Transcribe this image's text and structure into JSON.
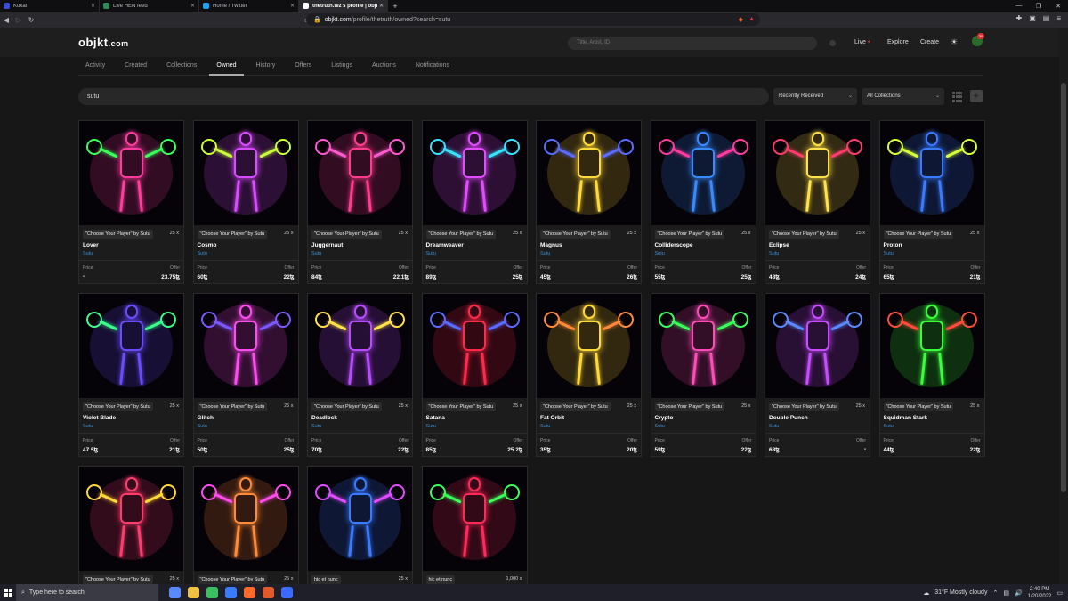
{
  "browser": {
    "tabs": [
      {
        "label": "Kokai",
        "color": "#3b4bd8"
      },
      {
        "label": "Live HEN feed",
        "color": "#2e8b57"
      },
      {
        "label": "Home / Twitter",
        "color": "#1da1f2"
      },
      {
        "label": "thetruth.tez's profile | objkt.com",
        "color": "#ffffff",
        "active": true
      }
    ],
    "new_tab": "+",
    "window_controls": [
      "—",
      "❐",
      "✕"
    ],
    "url_host": "objkt.com",
    "url_path": "/profile/thetruth/owned?search=sutu"
  },
  "header": {
    "logo": "objkt",
    "logo_suffix": ".com",
    "search_placeholder": "Title, Artist, ID",
    "live": "Live",
    "explore": "Explore",
    "create": "Create",
    "notifications_count": "39"
  },
  "subnav": [
    "Activity",
    "Created",
    "Collections",
    "Owned",
    "History",
    "Offers",
    "Listings",
    "Auctions",
    "Notifications"
  ],
  "subnav_active": "Owned",
  "filter": {
    "search_value": "sutu",
    "sort": "Recently Received",
    "collections": "All Collections"
  },
  "labels": {
    "price": "Price",
    "offer": "Offer"
  },
  "cards": [
    {
      "collection": "\"Choose Your Player\" by Sutu",
      "editions": "25 x",
      "title": "Lover",
      "artist": "Sutu",
      "price": "-",
      "offer": "23.75ꜩ",
      "c1": "#ff3c9e",
      "c2": "#39ff5a"
    },
    {
      "collection": "\"Choose Your Player\" by Sutu",
      "editions": "25 x",
      "title": "Cosmo",
      "artist": "Sutu",
      "price": "60ꜩ",
      "offer": "22ꜩ",
      "c1": "#d84cff",
      "c2": "#c8ff3a"
    },
    {
      "collection": "\"Choose Your Player\" by Sutu",
      "editions": "25 x",
      "title": "Juggernaut",
      "artist": "Sutu",
      "price": "84ꜩ",
      "offer": "22.1ꜩ",
      "c1": "#ff3c8e",
      "c2": "#ff5ad0"
    },
    {
      "collection": "\"Choose Your Player\" by Sutu",
      "editions": "25 x",
      "title": "Dreamweaver",
      "artist": "Sutu",
      "price": "89ꜩ",
      "offer": "25ꜩ",
      "c1": "#e24cff",
      "c2": "#37e4ff"
    },
    {
      "collection": "\"Choose Your Player\" by Sutu",
      "editions": "25 x",
      "title": "Magnus",
      "artist": "Sutu",
      "price": "45ꜩ",
      "offer": "26ꜩ",
      "c1": "#ffd83a",
      "c2": "#5a6bff"
    },
    {
      "collection": "\"Choose Your Player\" by Sutu",
      "editions": "25 x",
      "title": "Colliderscope",
      "artist": "Sutu",
      "price": "55ꜩ",
      "offer": "25ꜩ",
      "c1": "#3a8aff",
      "c2": "#ff3c9e"
    },
    {
      "collection": "\"Choose Your Player\" by Sutu",
      "editions": "25 x",
      "title": "Eclipse",
      "artist": "Sutu",
      "price": "48ꜩ",
      "offer": "24ꜩ",
      "c1": "#ffe24a",
      "c2": "#ff3c6e"
    },
    {
      "collection": "\"Choose Your Player\" by Sutu",
      "editions": "25 x",
      "title": "Proton",
      "artist": "Sutu",
      "price": "65ꜩ",
      "offer": "21ꜩ",
      "c1": "#3a7aff",
      "c2": "#d8ff3a"
    },
    {
      "collection": "\"Choose Your Player\" by Sutu",
      "editions": "25 x",
      "title": "Violet Blade",
      "artist": "Sutu",
      "price": "47.5ꜩ",
      "offer": "21ꜩ",
      "c1": "#6a4cff",
      "c2": "#39ff8a"
    },
    {
      "collection": "\"Choose Your Player\" by Sutu",
      "editions": "25 x",
      "title": "Glitch",
      "artist": "Sutu",
      "price": "50ꜩ",
      "offer": "25ꜩ",
      "c1": "#ff4cf0",
      "c2": "#7a5aff"
    },
    {
      "collection": "\"Choose Your Player\" by Sutu",
      "editions": "25 x",
      "title": "Deadlock",
      "artist": "Sutu",
      "price": "70ꜩ",
      "offer": "22ꜩ",
      "c1": "#b84cff",
      "c2": "#ffe24a"
    },
    {
      "collection": "\"Choose Your Player\" by Sutu",
      "editions": "25 x",
      "title": "Satana",
      "artist": "Sutu",
      "price": "85ꜩ",
      "offer": "25.2ꜩ",
      "c1": "#ff2a4a",
      "c2": "#5a6bff"
    },
    {
      "collection": "\"Choose Your Player\" by Sutu",
      "editions": "25 x",
      "title": "Fat Orbit",
      "artist": "Sutu",
      "price": "35ꜩ",
      "offer": "20ꜩ",
      "c1": "#ffd83a",
      "c2": "#ff8a3a"
    },
    {
      "collection": "\"Choose Your Player\" by Sutu",
      "editions": "25 x",
      "title": "Crypto",
      "artist": "Sutu",
      "price": "59ꜩ",
      "offer": "22ꜩ",
      "c1": "#ff4cb8",
      "c2": "#39ff5a"
    },
    {
      "collection": "\"Choose Your Player\" by Sutu",
      "editions": "25 x",
      "title": "Double Punch",
      "artist": "Sutu",
      "price": "68ꜩ",
      "offer": "-",
      "c1": "#c84cff",
      "c2": "#5a8aff"
    },
    {
      "collection": "\"Choose Your Player\" by Sutu",
      "editions": "25 x",
      "title": "Squidman Stark",
      "artist": "Sutu",
      "price": "44ꜩ",
      "offer": "22ꜩ",
      "c1": "#39ff3a",
      "c2": "#ff4c3a"
    },
    {
      "collection": "\"Choose Your Player\" by Sutu",
      "editions": "25 x",
      "title": "",
      "artist": "",
      "price": "",
      "offer": "",
      "c1": "#ff3c6e",
      "c2": "#ffd83a"
    },
    {
      "collection": "\"Choose Your Player\" by Sutu",
      "editions": "25 x",
      "title": "",
      "artist": "",
      "price": "",
      "offer": "",
      "c1": "#ff8a3a",
      "c2": "#ff4cf0"
    },
    {
      "collection": "hic et nunc",
      "editions": "25 x",
      "title": "",
      "artist": "",
      "price": "",
      "offer": "",
      "c1": "#3a7aff",
      "c2": "#e24cff"
    },
    {
      "collection": "hic et nunc",
      "editions": "1,000 x",
      "title": "",
      "artist": "",
      "price": "",
      "offer": "",
      "c1": "#ff2a5a",
      "c2": "#39ff5a"
    }
  ],
  "taskbar": {
    "search_placeholder": "Type here to search",
    "weather": "31°F  Mostly cloudy",
    "time": "2:40 PM",
    "date": "1/20/2022",
    "apps": [
      "#5a8aff",
      "#f0c040",
      "#3ac060",
      "#3a7aff",
      "#ff6a2a",
      "#e05a2a",
      "#3a6aff"
    ]
  }
}
